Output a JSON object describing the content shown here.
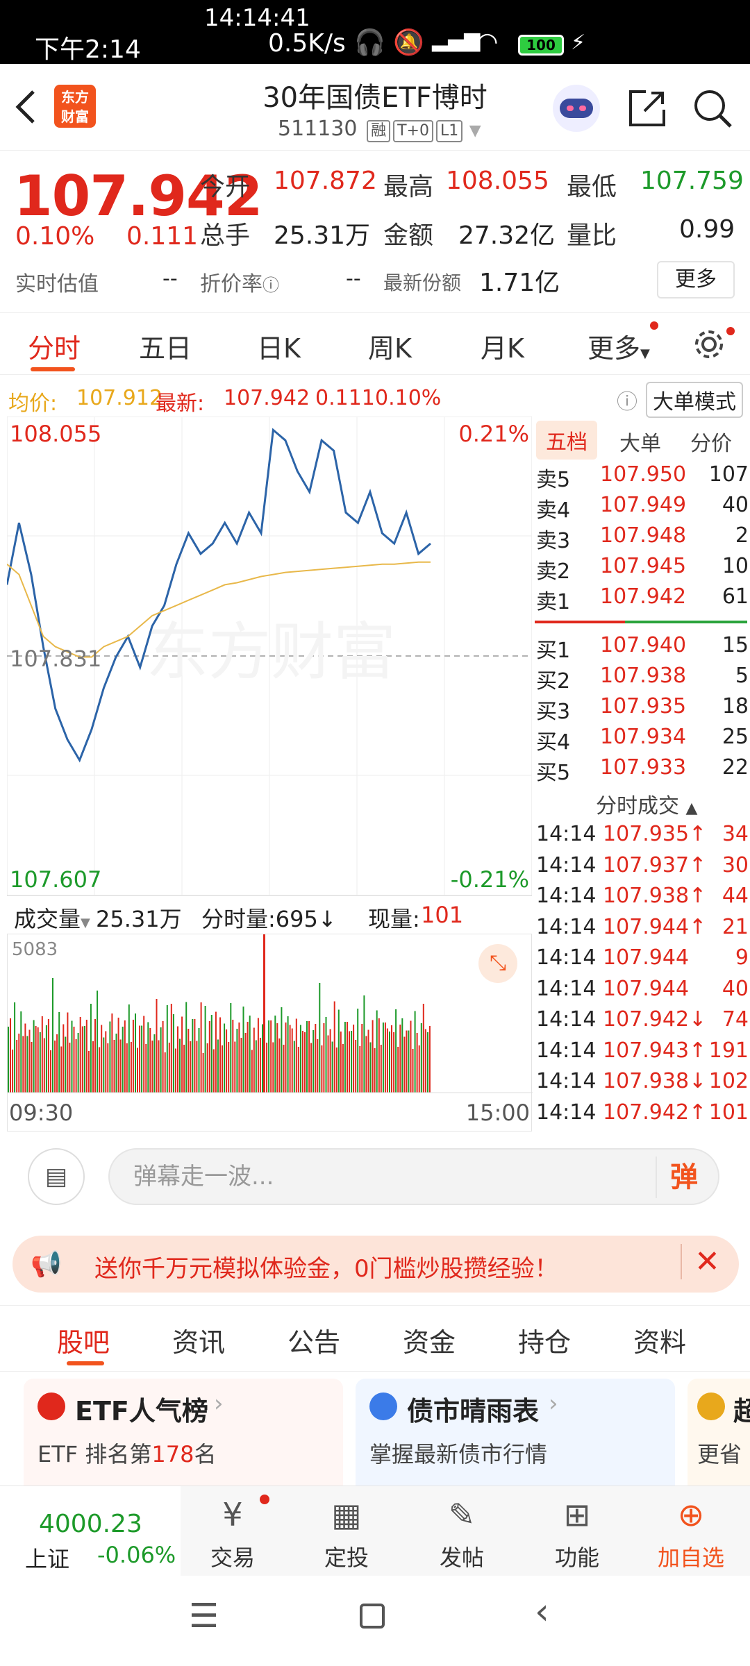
{
  "status": {
    "time_top": "14:14:41",
    "time": "下午2:14",
    "speed": "0.5K/s",
    "battery": "100"
  },
  "header": {
    "logo": "东方\n财富",
    "title": "30年国债ETF博时",
    "code": "511130",
    "tags": [
      "融",
      "T+0",
      "L1"
    ]
  },
  "quote": {
    "price": "107.942",
    "change_pct": "0.10%",
    "change": "0.111",
    "open_label": "今开",
    "open": "107.872",
    "high_label": "最高",
    "high": "108.055",
    "low_label": "最低",
    "low": "107.759",
    "vol_label": "总手",
    "vol": "25.31万",
    "amount_label": "金额",
    "amount": "27.32亿",
    "ratio_label": "量比",
    "ratio": "0.99",
    "est_label": "实时估值",
    "est": "--",
    "premium_label": "折价率",
    "premium": "--",
    "shares_label": "最新份额",
    "shares": "1.71亿",
    "more": "更多"
  },
  "chart_tabs": [
    "分时",
    "五日",
    "日K",
    "周K",
    "月K",
    "更多"
  ],
  "avg": {
    "avg_label": "均价:",
    "avg": "107.912",
    "latest_label": "最新:",
    "latest": "107.942",
    "chg": "0.111",
    "pct": "0.10%",
    "mode": "大单模式"
  },
  "chart_data": {
    "type": "line",
    "ylim": [
      107.607,
      108.055
    ],
    "y_top_label": "108.055",
    "y_bottom_label": "107.607",
    "y_mid_label": "107.831",
    "pct_top": "0.21%",
    "pct_bottom": "-0.21%",
    "x_start": "09:30",
    "x_end": "15:00",
    "watermark": "东方财富",
    "series": [
      {
        "values": [
          107.9,
          107.96,
          107.91,
          107.84,
          107.78,
          107.75,
          107.73,
          107.76,
          107.8,
          107.83,
          107.85,
          107.82,
          107.86,
          107.88,
          107.92,
          107.95,
          107.93,
          107.94,
          107.96,
          107.94,
          107.97,
          107.95,
          108.05,
          108.04,
          108.01,
          107.99,
          108.04,
          108.03,
          107.97,
          107.96,
          107.99,
          107.95,
          107.94,
          107.97,
          107.93,
          107.94
        ]
      },
      {
        "values": [
          107.92,
          107.91,
          107.88,
          107.85,
          107.84,
          107.835,
          107.83,
          107.83,
          107.84,
          107.845,
          107.85,
          107.86,
          107.87,
          107.875,
          107.88,
          107.885,
          107.89,
          107.895,
          107.9,
          107.902,
          107.905,
          107.908,
          107.91,
          107.912,
          107.913,
          107.914,
          107.915,
          107.916,
          107.917,
          107.918,
          107.919,
          107.92,
          107.92,
          107.921,
          107.922,
          107.922
        ]
      }
    ]
  },
  "trade_tabs": [
    "五档",
    "大单",
    "分价"
  ],
  "asks": [
    {
      "label": "卖5",
      "price": "107.950",
      "vol": "107"
    },
    {
      "label": "卖4",
      "price": "107.949",
      "vol": "40"
    },
    {
      "label": "卖3",
      "price": "107.948",
      "vol": "2"
    },
    {
      "label": "卖2",
      "price": "107.945",
      "vol": "10"
    },
    {
      "label": "卖1",
      "price": "107.942",
      "vol": "61"
    }
  ],
  "bids": [
    {
      "label": "买1",
      "price": "107.940",
      "vol": "15"
    },
    {
      "label": "买2",
      "price": "107.938",
      "vol": "5"
    },
    {
      "label": "买3",
      "price": "107.935",
      "vol": "18"
    },
    {
      "label": "买4",
      "price": "107.934",
      "vol": "25"
    },
    {
      "label": "买5",
      "price": "107.933",
      "vol": "22"
    }
  ],
  "ticks_title": "分时成交",
  "ticks": [
    {
      "time": "14:14",
      "price": "107.935↑",
      "vol": "34"
    },
    {
      "time": "14:14",
      "price": "107.937↑",
      "vol": "30"
    },
    {
      "time": "14:14",
      "price": "107.938↑",
      "vol": "44"
    },
    {
      "time": "14:14",
      "price": "107.944↑",
      "vol": "21"
    },
    {
      "time": "14:14",
      "price": "107.944",
      "vol": "9"
    },
    {
      "time": "14:14",
      "price": "107.944",
      "vol": "40"
    },
    {
      "time": "14:14",
      "price": "107.942↓",
      "vol": "74"
    },
    {
      "time": "14:14",
      "price": "107.943↑",
      "vol": "191"
    },
    {
      "time": "14:14",
      "price": "107.938↓",
      "vol": "102"
    },
    {
      "time": "14:14",
      "price": "107.942↑",
      "vol": "101"
    }
  ],
  "volbar": {
    "label": "成交量",
    "value": "25.31万",
    "minute": "分时量:695↓",
    "now_label": "现量:",
    "now": "101",
    "max": "5083"
  },
  "comment": {
    "placeholder": "弹幕走一波...",
    "danmu": "弹"
  },
  "banner": {
    "text": "送你千万元模拟体验金，0门槛炒股攒经验！"
  },
  "bottom_tabs": [
    "股吧",
    "资讯",
    "公告",
    "资金",
    "持仓",
    "资料"
  ],
  "cards": [
    {
      "title": "ETF人气榜",
      "sub_a": "ETF 排名第",
      "rank": "178",
      "sub_b": "名"
    },
    {
      "title": "债市晴雨表",
      "sub": "掌握最新债市行情"
    },
    {
      "title": "超",
      "sub": "更省"
    }
  ],
  "nav": {
    "index_value": "4000.23",
    "index_name": "上证",
    "index_change": "-0.06%",
    "items": [
      "交易",
      "定投",
      "发帖",
      "功能",
      "加自选"
    ]
  }
}
